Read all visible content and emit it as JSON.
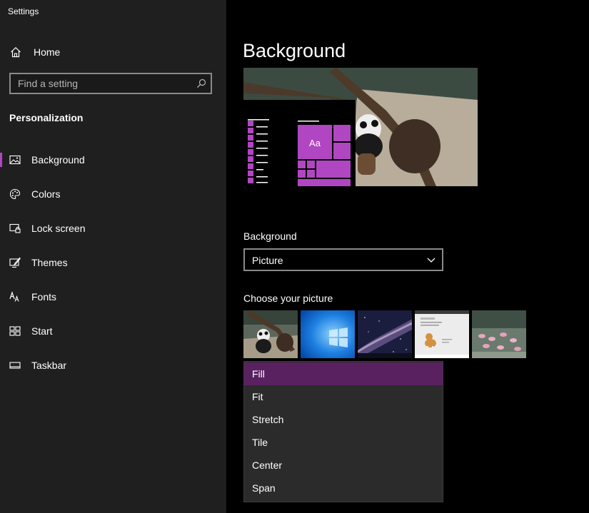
{
  "window": {
    "title": "Settings"
  },
  "sidebar": {
    "home_label": "Home",
    "search_placeholder": "Find a setting",
    "section": "Personalization",
    "items": [
      {
        "label": "Background",
        "icon": "picture-icon",
        "active": true
      },
      {
        "label": "Colors",
        "icon": "palette-icon",
        "active": false
      },
      {
        "label": "Lock screen",
        "icon": "lock-screen-icon",
        "active": false
      },
      {
        "label": "Themes",
        "icon": "themes-icon",
        "active": false
      },
      {
        "label": "Fonts",
        "icon": "fonts-icon",
        "active": false
      },
      {
        "label": "Start",
        "icon": "start-icon",
        "active": false
      },
      {
        "label": "Taskbar",
        "icon": "taskbar-icon",
        "active": false
      }
    ]
  },
  "main": {
    "title": "Background",
    "preview": {
      "tile_text": "Aa",
      "accent": "#b146c2"
    },
    "background_label": "Background",
    "background_value": "Picture",
    "choose_label": "Choose your picture",
    "thumbnails": [
      {
        "name": "panda-thumbnail"
      },
      {
        "name": "windows-logo-thumbnail"
      },
      {
        "name": "galaxy-thumbnail"
      },
      {
        "name": "corgi-page-thumbnail"
      },
      {
        "name": "flamingos-thumbnail"
      }
    ],
    "fit_menu": {
      "options": [
        "Fill",
        "Fit",
        "Stretch",
        "Tile",
        "Center",
        "Span"
      ],
      "selected": "Fill"
    }
  },
  "colors": {
    "sidebar_bg": "#1f1f1f",
    "main_bg": "#000000",
    "accent": "#b146c2",
    "menu_bg": "#2b2b2b",
    "menu_selected": "#5a2161"
  }
}
